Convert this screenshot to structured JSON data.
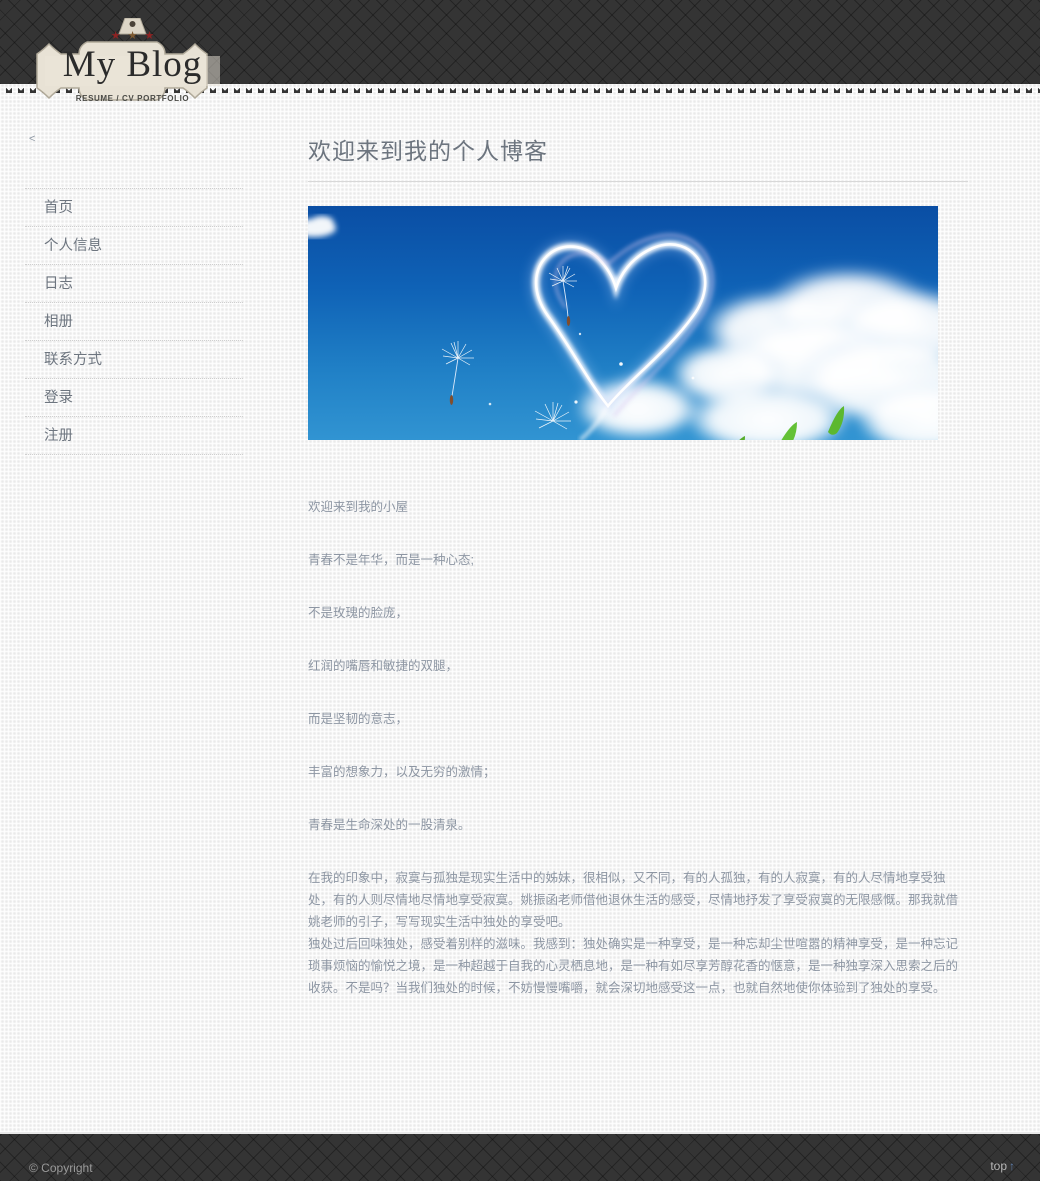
{
  "header": {
    "logo": {
      "title": "My Blog",
      "subtitle": "RESUME / CV PORTFOLIO",
      "star_glyph": "★",
      "colors": {
        "badge_fill": "#e8e2d5",
        "badge_border": "#b8b2a4",
        "star_dark_red": "#8e2323",
        "star_brown": "#7d5a32",
        "header_bg": "#343434"
      }
    }
  },
  "sidebar": {
    "toggle_label": "<",
    "items": [
      {
        "label": "首页"
      },
      {
        "label": "个人信息"
      },
      {
        "label": "日志"
      },
      {
        "label": "相册"
      },
      {
        "label": "联系方式"
      },
      {
        "label": "登录"
      },
      {
        "label": "注册"
      }
    ]
  },
  "main": {
    "title": "欢迎来到我的个人博客",
    "banner": {
      "alt": "blue sky with heart-shaped cloud trail, dandelion seeds and green leaves",
      "sky_top": "#0a4ea4",
      "sky_bottom": "#3194d2"
    },
    "paragraphs": [
      "欢迎来到我的小屋",
      "青春不是年华，而是一种心态;",
      "不是玫瑰的脸庞，",
      "红润的嘴唇和敏捷的双腿，",
      "而是坚韧的意志，",
      "丰富的想象力，以及无穷的激情；",
      "青春是生命深处的一股清泉。"
    ],
    "long_paragraphs": [
      "在我的印象中，寂寞与孤独是现实生活中的姊妹，很相似，又不同，有的人孤独，有的人寂寞，有的人尽情地享受独处，有的人则尽情地尽情地享受寂寞。姚振函老师借他退休生活的感受，尽情地抒发了享受寂寞的无限感慨。那我就借姚老师的引子，写写现实生活中独处的享受吧。",
      "独处过后回味独处，感受着别样的滋味。我感到：独处确实是一种享受，是一种忘却尘世喧嚣的精神享受，是一种忘记琐事烦恼的愉悦之境，是一种超越于自我的心灵栖息地，是一种有如尽享芳醇花香的惬意，是一种独享深入思索之后的收获。不是吗？当我们独处的时候，不妨慢慢嘴嚼，就会深切地感受这一点，也就自然地使你体验到了独处的享受。"
    ]
  },
  "footer": {
    "copyright": "© Copyright",
    "top_label": "top",
    "top_arrow": "↑"
  }
}
